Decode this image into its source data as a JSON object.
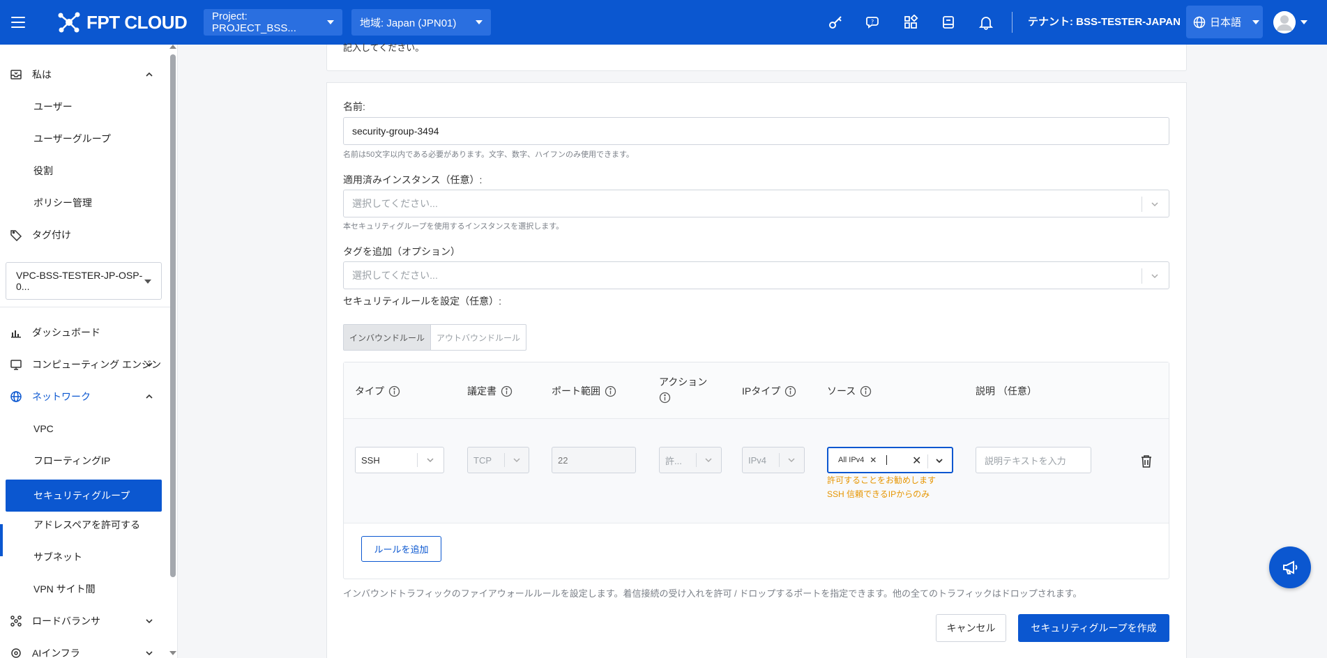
{
  "header": {
    "logo_text": "FPT CLOUD",
    "project_select": "Project: PROJECT_BSS...",
    "region_select": "地域: Japan (JPN01)",
    "tenant": "テナント: BSS-TESTER-JAPAN",
    "language": "日本語"
  },
  "sidebar": {
    "iam_section": "私は",
    "users": "ユーザー",
    "user_groups": "ユーザーグループ",
    "roles": "役割",
    "policy_management": "ポリシー管理",
    "tagging": "タグ付け",
    "vpc_select": "VPC-BSS-TESTER-JP-OSP-0...",
    "dashboard": "ダッシュボード",
    "compute_engine": "コンピューティング エンジン",
    "network": "ネットワーク",
    "vpc": "VPC",
    "floating_ip": "フローティングIP",
    "security_group": "セキュリティグループ",
    "allowed_address_pair": "アドレスペアを許可する",
    "subnet": "サブネット",
    "vpn_site": "VPN サイト間",
    "load_balancer": "ロードバランサ",
    "ai_infra": "AIインフラ"
  },
  "form": {
    "top_text": "記入してください。",
    "name_label": "名前:",
    "name_value": "security-group-3494",
    "name_hint": "名前は50文字以内である必要があります。文字、数字、ハイフンのみ使用できます。",
    "instances_label": "適用済みインスタンス（任意）:",
    "instances_placeholder": "選択してください...",
    "instances_hint": "本セキュリティグループを使用するインスタンスを選択します。",
    "tags_label": "タグを追加（オプション）",
    "tags_placeholder": "選択してください...",
    "rules_label": "セキュリティルールを設定（任意）:",
    "tab_inbound": "インバウンドルール",
    "tab_outbound": "アウトバウンドルール"
  },
  "rules_table": {
    "columns": {
      "type": "タイプ",
      "protocol": "議定書",
      "port_range": "ポート範囲",
      "action": "アクション",
      "ip_type": "IPタイプ",
      "source": "ソース",
      "description": "説明 （任意）"
    },
    "row": {
      "type": "SSH",
      "protocol": "TCP",
      "port": "22",
      "action": "許...",
      "ip_type": "IPv4",
      "source_tag": "All IPv4",
      "description_placeholder": "説明テキストを入力",
      "warning_line1": "許可することをお勧めします",
      "warning_line2": "SSH 信頼できるIPからのみ"
    },
    "add_rule": "ルールを追加"
  },
  "footer": {
    "note": "インバウンドトラフィックのファイアウォールルールを設定します。着信接続の受け入れを許可 / ドロップするポートを指定できます。他の全てのトラフィックはドロップされます。",
    "cancel": "キャンセル",
    "create": "セキュリティグループを作成"
  },
  "colors": {
    "brand": "#0b57d0",
    "warning": "#e69500"
  }
}
